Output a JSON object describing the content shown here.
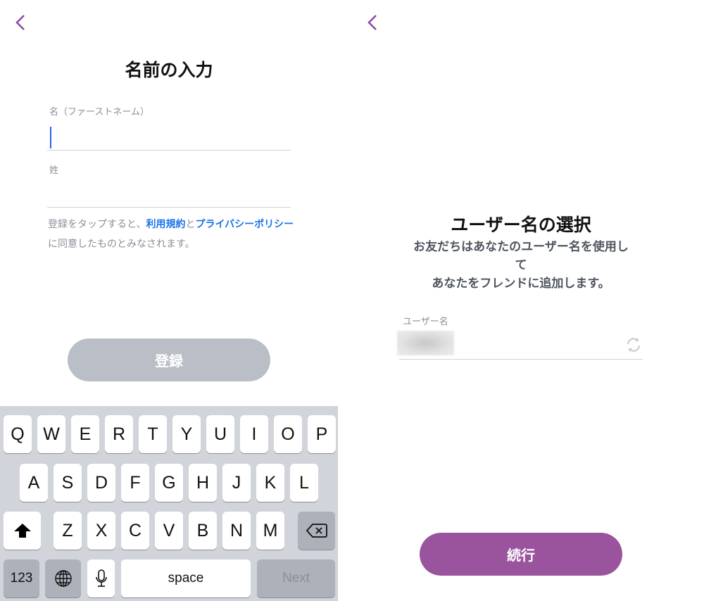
{
  "left_screen": {
    "title": "名前の入力",
    "first_name": {
      "label": "名（ファーストネーム）",
      "value": "",
      "placeholder": ""
    },
    "last_name": {
      "label": "姓",
      "value": "",
      "placeholder": ""
    },
    "legal": {
      "prefix": "登録をタップすると、",
      "terms_link": "利用規約",
      "and": "と",
      "privacy_link": "プライバシーポリシー",
      "suffix": "に同意したものとみなされます。"
    },
    "register_button": "登録",
    "keyboard": {
      "row1": [
        "Q",
        "W",
        "E",
        "R",
        "T",
        "Y",
        "U",
        "I",
        "O",
        "P"
      ],
      "row2": [
        "A",
        "S",
        "D",
        "F",
        "G",
        "H",
        "J",
        "K",
        "L"
      ],
      "row3": [
        "Z",
        "X",
        "C",
        "V",
        "B",
        "N",
        "M"
      ],
      "numbers_key": "123",
      "space_key": "space",
      "next_key": "Next",
      "icons": {
        "shift": "shift-icon",
        "backspace": "backspace-icon",
        "globe": "globe-icon",
        "mic": "microphone-icon"
      }
    }
  },
  "right_screen": {
    "title": "ユーザー名の選択",
    "subtitle_lines": [
      "お友だちはあなたのユーザー名を使用し",
      "て",
      "あなたをフレンドに追加します。"
    ],
    "username": {
      "label": "ユーザー名",
      "value": "(blurred)"
    },
    "continue_button": "続行"
  },
  "colors": {
    "accent": "#9a539d",
    "link": "#1a73e8",
    "disabled_button": "#b9bec7",
    "caret": "#2d62e6"
  }
}
